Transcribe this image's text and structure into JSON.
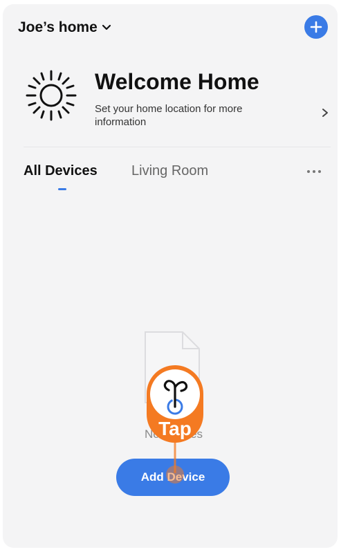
{
  "header": {
    "home_name": "Joe’s home",
    "accent_color": "#3a7be6"
  },
  "welcome": {
    "title": "Welcome Home",
    "subtitle": "Set your home location for more information"
  },
  "tabs": [
    {
      "label": "All Devices",
      "active": true
    },
    {
      "label": "Living Room",
      "active": false
    }
  ],
  "empty_state": {
    "text": "No devices"
  },
  "actions": {
    "add_device_label": "Add Device"
  },
  "overlay": {
    "tap_label": "Tap",
    "color": "#f47a22"
  }
}
